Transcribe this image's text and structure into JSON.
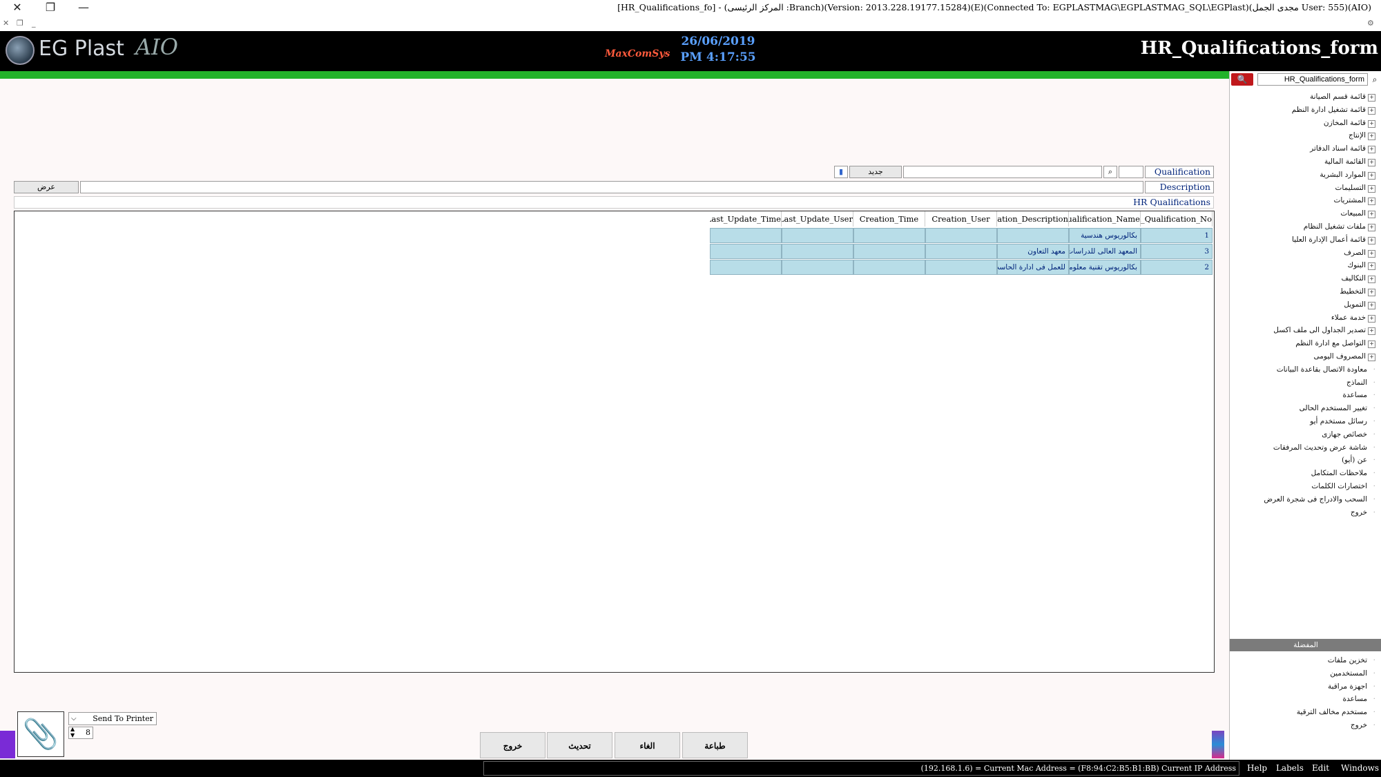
{
  "window": {
    "title": "[HR_Qualifications_fo] - (المركز الرئيسى :Branch)(Version: 2013.228.19177.15284)(E)(Connected To: EGPLASTMAG\\EGPLASTMAG_SQL\\EGPlast)(مجدى الجمل User: 555)(AIO)"
  },
  "header": {
    "logo_text": "EG Plast",
    "logo_suffix": "AIO",
    "badge": "MaxComSys",
    "date": "26/06/2019",
    "time": "PM 4:17:55",
    "form_title": "HR_Qualifications_form"
  },
  "sidebar": {
    "search_value": "HR_Qualifications_form",
    "items": [
      {
        "label": "قائمة قسم الصيانة",
        "expandable": true
      },
      {
        "label": "قائمة تشغيل ادارة النظم",
        "expandable": true
      },
      {
        "label": "قائمة المخازن",
        "expandable": true
      },
      {
        "label": "الإنتاج",
        "expandable": true
      },
      {
        "label": "قائمة اسناد الدفاتر",
        "expandable": true
      },
      {
        "label": "القائمة المالية",
        "expandable": true
      },
      {
        "label": "الموارد البشرية",
        "expandable": true
      },
      {
        "label": "التسليمات",
        "expandable": true
      },
      {
        "label": "المشتريات",
        "expandable": true
      },
      {
        "label": "المبيعات",
        "expandable": true
      },
      {
        "label": "ملفات تشغيل النظام",
        "expandable": true
      },
      {
        "label": "قائمة أعمال الإدارة العليا",
        "expandable": true
      },
      {
        "label": "الصرف",
        "expandable": true
      },
      {
        "label": "البنوك",
        "expandable": true
      },
      {
        "label": "التكاليف",
        "expandable": true
      },
      {
        "label": "التخطيط",
        "expandable": true
      },
      {
        "label": "التمويل",
        "expandable": true
      },
      {
        "label": "خدمة عملاء",
        "expandable": true
      },
      {
        "label": "تصدير الجداول الى ملف اكسل",
        "expandable": true
      },
      {
        "label": "التواصل مع ادارة النظم",
        "expandable": true
      },
      {
        "label": "المصروف اليومى",
        "expandable": true
      },
      {
        "label": "معاودة الاتصال بقاعدة البيانات",
        "expandable": false
      },
      {
        "label": "النماذج",
        "expandable": false
      },
      {
        "label": "مساعدة",
        "expandable": false
      },
      {
        "label": "تغيير المستخدم الحالى",
        "expandable": false
      },
      {
        "label": "رسائل مستخدم أيو",
        "expandable": false
      },
      {
        "label": "خصائص جهازى",
        "expandable": false
      },
      {
        "label": "شاشة عرض وتحديث المرفقات",
        "expandable": false
      },
      {
        "label": "عن (أيو)",
        "expandable": false
      },
      {
        "label": "ملاحظات المتكامل",
        "expandable": false
      },
      {
        "label": "اختصارات الكلمات",
        "expandable": false
      },
      {
        "label": "السحب والادراج فى شجرة العرض",
        "expandable": false
      },
      {
        "label": "خروج",
        "expandable": false
      }
    ],
    "favorites_header": "المفضلة",
    "favorites": [
      {
        "label": "تخزين ملفات"
      },
      {
        "label": "المستخدمين"
      },
      {
        "label": "اجهزة مراقبة"
      },
      {
        "label": "مساعدة"
      },
      {
        "label": "مستخدم مخالف الترقية"
      },
      {
        "label": "خروج"
      }
    ]
  },
  "form": {
    "qualification_label": "Qualification",
    "qualification_value": "",
    "new_button": "جديد",
    "description_label": "Description",
    "view_button": "عرض",
    "section_title": "HR Qualifications"
  },
  "grid": {
    "columns": [
      "HR_Qualification_No",
      "HR_Qualification_Name",
      "Qualification_Description",
      "Creation_User",
      "Creation_Time",
      "Last_Update_User",
      "Last_Update_Time"
    ],
    "rows": [
      [
        "1",
        "بكالوريوس هندسية",
        "",
        "",
        "",
        "",
        ""
      ],
      [
        "3",
        "المعهد العالى للدراسات",
        "معهد التعاون",
        "",
        "",
        "",
        ""
      ],
      [
        "2",
        "بكالوريوس تقنية معلومات",
        "للعمل فى ادارة الحاسب",
        "",
        "",
        "",
        ""
      ]
    ]
  },
  "bottom": {
    "printer_label": "Send To Printer",
    "copies": "8",
    "buttons": [
      "طباعة",
      "الغاء",
      "تحديث",
      "خروج"
    ]
  },
  "status": {
    "text": "(192.168.1.6) = Current Mac Address = (F8:94:C2:B5:B1:BB) Current IP Address",
    "menus": [
      "Help",
      "Labels",
      "Edit",
      "Windows"
    ]
  },
  "colors": {
    "header_bg": "#000000",
    "accent_green": "#22b22a",
    "grid_cell": "#b8dde8",
    "label_text": "#00237a",
    "search_red": "#c0181c"
  }
}
